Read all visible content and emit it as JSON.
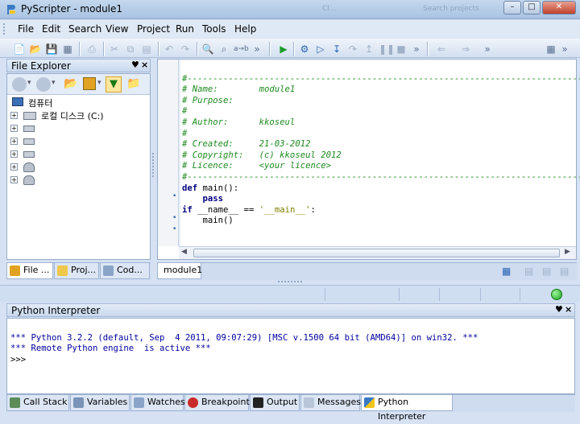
{
  "window": {
    "title": "PyScripter - module1",
    "ghost_text_1": "Cl...",
    "ghost_text_2": "Search projects"
  },
  "menu": [
    "File",
    "Edit",
    "Search",
    "View",
    "Project",
    "Run",
    "Tools",
    "Help"
  ],
  "file_explorer": {
    "title": "File Explorer",
    "tree": [
      {
        "label": "컴퓨터"
      },
      {
        "label": "로컬 디스크 (C:)"
      },
      {
        "label": ""
      },
      {
        "label": ""
      },
      {
        "label": ""
      },
      {
        "label": ""
      },
      {
        "label": ""
      }
    ],
    "tabs": [
      "File ...",
      "Proj...",
      "Cod..."
    ]
  },
  "editor": {
    "lines": [
      "#-------------------------------------------------------------------------------",
      "# Name:        module1",
      "# Purpose:",
      "#",
      "# Author:      kkoseul",
      "#",
      "# Created:     21-03-2012",
      "# Copyright:   (c) kkoseul 2012",
      "# Licence:     <your licence>",
      "#-------------------------------------------------------------------------------",
      "",
      "def main():",
      "    pass",
      "",
      "if __name__ == '__main__':",
      "    main()"
    ],
    "tab_label": "module1"
  },
  "interpreter": {
    "title": "Python Interpreter",
    "output": [
      "*** Python 3.2.2 (default, Sep  4 2011, 09:07:29) [MSC v.1500 64 bit (AMD64)] on win32. ***",
      "*** Remote Python engine  is active ***",
      ">>>"
    ]
  },
  "bottom_tabs": [
    "Call Stack",
    "Variables",
    "Watches",
    "Breakpoints",
    "Output",
    "Messages",
    "Python Interpreter"
  ],
  "colors": {
    "comment": "#1e8a1e",
    "keyword": "#00007f",
    "string": "#7f7f00"
  }
}
